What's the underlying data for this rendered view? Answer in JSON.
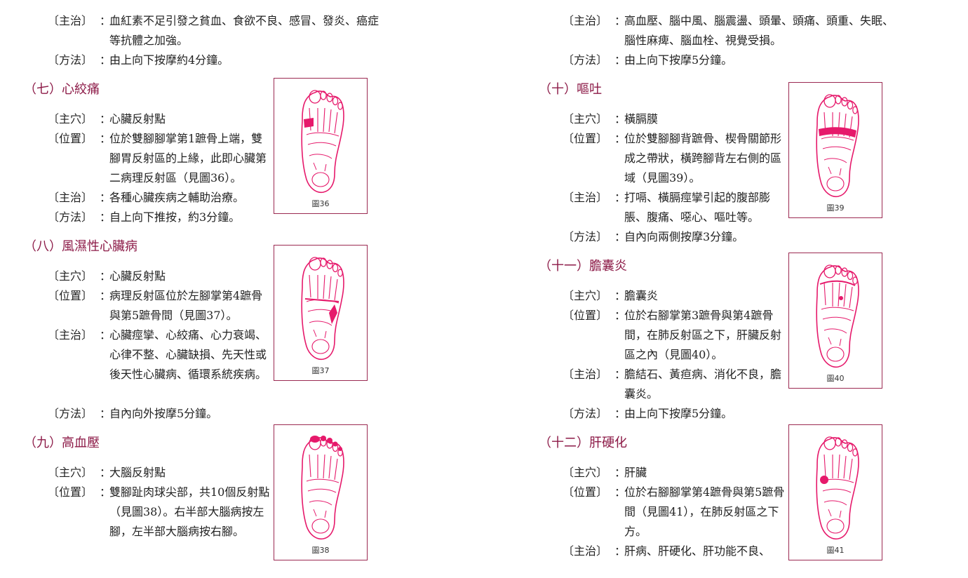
{
  "left": {
    "cont": {
      "zhuzhi": {
        "label": "〔主治〕",
        "text": "血紅素不足引發之貧血、食欲不良、感冒、發炎、癌症等抗體之加強。"
      },
      "fangfa": {
        "label": "〔方法〕",
        "text": "由上向下按摩約4分鐘。"
      }
    },
    "s7": {
      "title": "（七）心絞痛",
      "zhuxue": {
        "label": "〔主穴〕",
        "text": "心臟反射點"
      },
      "weizhi": {
        "label": "〔位置〕",
        "text": "位於雙腳腳掌第1蹠骨上端，雙腳胃反射區的上緣，此即心臟第二病理反射區（見圖36）。"
      },
      "zhuzhi": {
        "label": "〔主治〕",
        "text": "各種心臟疾病之輔助治療。"
      },
      "fangfa": {
        "label": "〔方法〕",
        "text": "自上向下推按，約3分鐘。"
      },
      "fig": "圖36"
    },
    "s8": {
      "title": "（八）風濕性心臟病",
      "zhuxue": {
        "label": "〔主穴〕",
        "text": "心臟反射點"
      },
      "weizhi": {
        "label": "〔位置〕",
        "text": "病理反射區位於左腳掌第4蹠骨與第5蹠骨間（見圖37）。"
      },
      "zhuzhi": {
        "label": "〔主治〕",
        "text": "心臟痙攣、心絞痛、心力衰竭、心律不整、心臟缺損、先天性或後天性心臟病、循環系統疾病。"
      },
      "fangfa": {
        "label": "〔方法〕",
        "text": "自內向外按摩5分鐘。"
      },
      "fig": "圖37"
    },
    "s9": {
      "title": "（九）高血壓",
      "zhuxue": {
        "label": "〔主穴〕",
        "text": "大腦反射點"
      },
      "weizhi": {
        "label": "〔位置〕",
        "text": "雙腳趾肉球尖部，共10個反射點（見圖38）。右半部大腦病按左腳，左半部大腦病按右腳。"
      },
      "fig": "圖38"
    }
  },
  "right": {
    "cont": {
      "zhuzhi": {
        "label": "〔主治〕",
        "text": "高血壓、腦中風、腦震盪、頭暈、頭痛、頭重、失眠、腦性麻痺、腦血栓、視覺受損。"
      },
      "fangfa": {
        "label": "〔方法〕",
        "text": "由上向下按摩5分鐘。"
      }
    },
    "s10": {
      "title": "（十）嘔吐",
      "zhuxue": {
        "label": "〔主穴〕",
        "text": "橫膈膜"
      },
      "weizhi": {
        "label": "〔位置〕",
        "text": "位於雙腳腳背蹠骨、楔骨關節形成之帶狀，橫跨腳背左右側的區域（見圖39）。"
      },
      "zhuzhi": {
        "label": "〔主治〕",
        "text": "打嗝、橫膈痙攣引起的腹部膨脹、腹痛、噁心、嘔吐等。"
      },
      "fangfa": {
        "label": "〔方法〕",
        "text": "自內向兩側按摩3分鐘。"
      },
      "fig": "圖39"
    },
    "s11": {
      "title": "（十一）膽囊炎",
      "zhuxue": {
        "label": "〔主穴〕",
        "text": "膽囊炎"
      },
      "weizhi": {
        "label": "〔位置〕",
        "text": "位於右腳掌第3蹠骨與第4蹠骨間，在肺反射區之下，肝臟反射區之內（見圖40）。"
      },
      "zhuzhi": {
        "label": "〔主治〕",
        "text": "膽結石、黃疸病、消化不良，膽囊炎。"
      },
      "fangfa": {
        "label": "〔方法〕",
        "text": "由上向下按摩5分鐘。"
      },
      "fig": "圖40"
    },
    "s12": {
      "title": "（十二）肝硬化",
      "zhuxue": {
        "label": "〔主穴〕",
        "text": "肝臟"
      },
      "weizhi": {
        "label": "〔位置〕",
        "text": "位於右腳腳掌第4蹠骨與第5蹠骨間（見圖41），在肺反射區之下方。"
      },
      "zhuzhi": {
        "label": "〔主治〕",
        "text": "肝病、肝硬化、肝功能不良、"
      },
      "fig": "圖41"
    }
  },
  "colors": {
    "title": "#8c1a47",
    "figure_ink": "#e6196b",
    "frame": "#9b2a52",
    "text": "#222222"
  }
}
